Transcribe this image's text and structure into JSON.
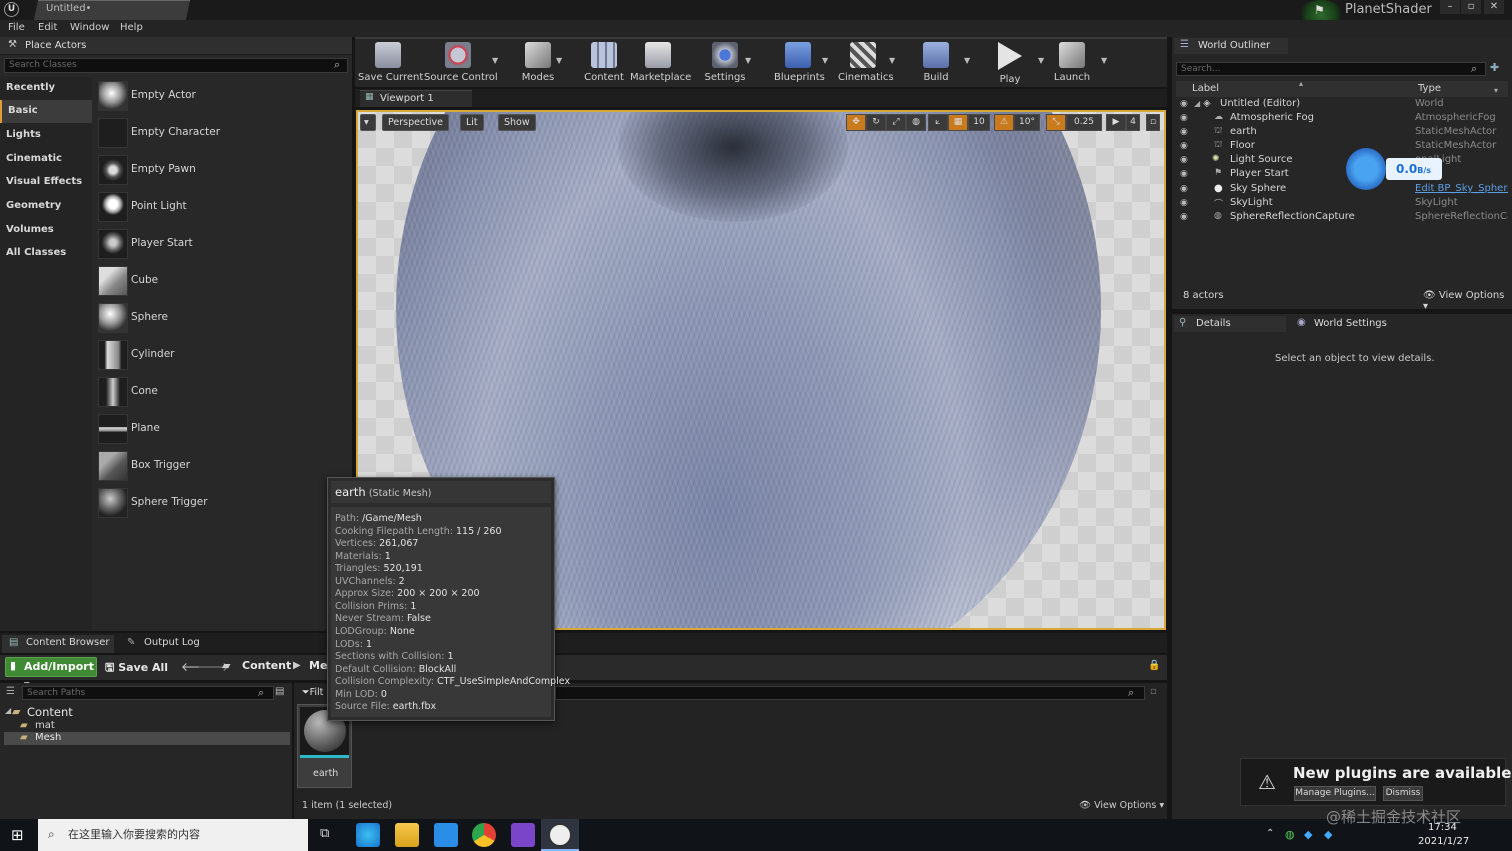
{
  "window": {
    "tab_title": "Untitled•",
    "project_name": "PlanetShader"
  },
  "menu": [
    "File",
    "Edit",
    "Window",
    "Help"
  ],
  "place_actors": {
    "title": "Place Actors",
    "search_placeholder": "Search Classes",
    "categories": [
      "Recently Placed",
      "Basic",
      "Lights",
      "Cinematic",
      "Visual Effects",
      "Geometry",
      "Volumes",
      "All Classes"
    ],
    "selected_category": "Basic",
    "items": [
      "Empty Actor",
      "Empty Character",
      "Empty Pawn",
      "Point Light",
      "Player Start",
      "Cube",
      "Sphere",
      "Cylinder",
      "Cone",
      "Plane",
      "Box Trigger",
      "Sphere Trigger"
    ]
  },
  "toolbar": [
    "Save Current",
    "Source Control",
    "Modes",
    "Content",
    "Marketplace",
    "Settings",
    "Blueprints",
    "Cinematics",
    "Build",
    "Play",
    "Launch"
  ],
  "viewport": {
    "tab": "Viewport 1",
    "perspective": "Perspective",
    "lit": "Lit",
    "show": "Show",
    "grid_snap": "10",
    "rot_snap": "10°",
    "scale_snap": "0.25",
    "camera_speed": "4"
  },
  "tooltip": {
    "name": "earth",
    "kind": "(Static Mesh)",
    "rows": [
      [
        "Path:",
        "/Game/Mesh"
      ],
      [
        "Cooking Filepath Length:",
        "115 / 260"
      ],
      [
        "Vertices:",
        "261,067"
      ],
      [
        "Materials:",
        "1"
      ],
      [
        "Triangles:",
        "520,191"
      ],
      [
        "UVChannels:",
        "2"
      ],
      [
        "Approx Size:",
        "200 × 200 × 200"
      ],
      [
        "Collision Prims:",
        "1"
      ],
      [
        "Never Stream:",
        "False"
      ],
      [
        "LODGroup:",
        "None"
      ],
      [
        "LODs:",
        "1"
      ],
      [
        "Sections with Collision:",
        "1"
      ],
      [
        "Default Collision:",
        "BlockAll"
      ],
      [
        "Collision Complexity:",
        "CTF_UseSimpleAndComplex"
      ],
      [
        "Min LOD:",
        "0"
      ],
      [
        "Source File:",
        "earth.fbx"
      ]
    ]
  },
  "content_browser": {
    "tabs": [
      "Content Browser",
      "Output Log"
    ],
    "add_import": "Add/Import",
    "save_all": "Save All",
    "breadcrumb": [
      "Content",
      "Me"
    ],
    "paths_placeholder": "Search Paths",
    "tree": {
      "root": "Content",
      "children": [
        "mat",
        "Mesh"
      ],
      "selected": "Mesh"
    },
    "filter_label": "Filt",
    "asset_name": "earth",
    "status": "1 item (1 selected)",
    "view_options": "View Options"
  },
  "outliner": {
    "title": "World Outliner",
    "search_placeholder": "Search...",
    "col_label": "Label",
    "col_type": "Type",
    "rows": [
      {
        "name": "Untitled (Editor)",
        "type": "World",
        "indent": 0
      },
      {
        "name": "Atmospheric Fog",
        "type": "AtmosphericFog",
        "indent": 1
      },
      {
        "name": "earth",
        "type": "StaticMeshActor",
        "indent": 1
      },
      {
        "name": "Floor",
        "type": "StaticMeshActor",
        "indent": 1
      },
      {
        "name": "Light Source",
        "type": "onalLight",
        "indent": 1
      },
      {
        "name": "Player Start",
        "type": "Start",
        "indent": 1
      },
      {
        "name": "Sky Sphere",
        "type": "Edit BP_Sky_Sphere",
        "indent": 1
      },
      {
        "name": "SkyLight",
        "type": "SkyLight",
        "indent": 1
      },
      {
        "name": "SphereReflectionCapture",
        "type": "SphereReflectionCapt",
        "indent": 1
      }
    ],
    "actor_count": "8 actors",
    "view_options": "View Options",
    "overlay_speed": "0.0",
    "overlay_unit": "B/s"
  },
  "details": {
    "tabs": [
      "Details",
      "World Settings"
    ],
    "empty_message": "Select an object to view details."
  },
  "notification": {
    "title": "New plugins are available",
    "manage": "Manage Plugins...",
    "dismiss": "Dismiss"
  },
  "taskbar": {
    "search": "在这里输入你要搜索的内容",
    "time": "17:34",
    "date": "2021/1/27",
    "watermark": "@稀土掘金技术社区"
  },
  "colors": {
    "accent": "#e29b3a",
    "add_green": "#3f8a33",
    "selection": "#2fb8c8"
  }
}
